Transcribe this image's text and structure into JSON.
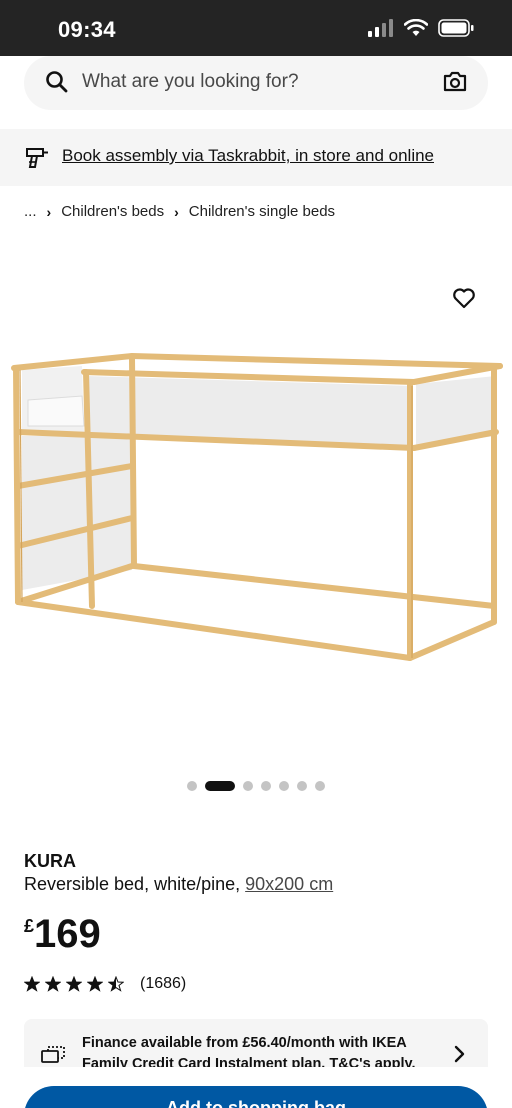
{
  "status_bar": {
    "time": "09:34"
  },
  "search": {
    "placeholder": "What are you looking for?"
  },
  "banner": {
    "text": "Book assembly via Taskrabbit, in store and online"
  },
  "breadcrumb": {
    "ellipsis": "...",
    "items": [
      "Children's beds",
      "Children's single beds"
    ]
  },
  "gallery": {
    "dot_count": 7,
    "active_index": 1
  },
  "product": {
    "name": "KURA",
    "description": "Reversible bed, white/pine,",
    "size": "90x200 cm",
    "currency": "£",
    "price": "169",
    "rating": 4.5,
    "rating_count": "(1686)"
  },
  "finance": {
    "text": "Finance available from £56.40/month with IKEA Family Credit Card Instalment plan. T&C's apply."
  },
  "cta": {
    "label": "Add to shopping bag"
  },
  "colors": {
    "accent": "#0058a3",
    "status_bar": "#242424",
    "panel": "#f5f5f5",
    "pine": "#e8c27e"
  }
}
